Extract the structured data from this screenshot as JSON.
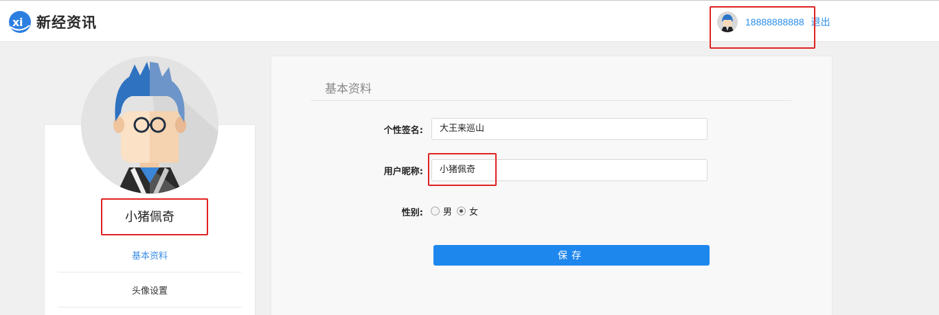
{
  "header": {
    "logo_text": "新经资讯",
    "user_phone": "18888888888",
    "logout_label": "退出"
  },
  "sidebar": {
    "nickname": "小猪佩奇",
    "menu": [
      {
        "label": "基本资料",
        "active": true
      },
      {
        "label": "头像设置",
        "active": false
      }
    ]
  },
  "form": {
    "section_title": "基本资料",
    "signature_label": "个性签名:",
    "signature_value": "大王来巡山",
    "nickname_label": "用户昵称:",
    "nickname_value": "小猪佩奇",
    "gender_label": "性别:",
    "gender_options": [
      "男",
      "女"
    ],
    "gender_selected": "女",
    "save_label": "保存"
  },
  "colors": {
    "accent": "#1e87ee",
    "link": "#2a8ee8",
    "highlight": "#e02020"
  }
}
